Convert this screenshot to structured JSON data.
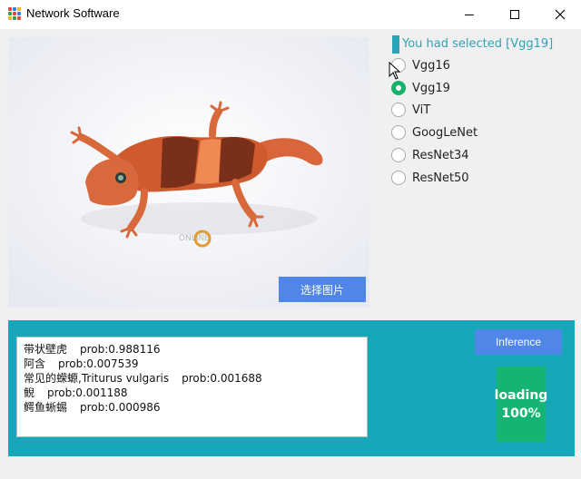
{
  "window": {
    "title": "Network Software"
  },
  "image_panel": {
    "image_subject": "gecko",
    "watermark": "ONLINE",
    "select_button_label": "选择图片"
  },
  "model_selection": {
    "selected_text": "You had selected [Vgg19]",
    "options": [
      {
        "label": "Vgg16",
        "checked": false
      },
      {
        "label": "Vgg19",
        "checked": true
      },
      {
        "label": "ViT",
        "checked": false
      },
      {
        "label": "GoogLeNet",
        "checked": false
      },
      {
        "label": "ResNet34",
        "checked": false
      },
      {
        "label": "ResNet50",
        "checked": false
      }
    ]
  },
  "results": [
    {
      "name": "带状壁虎",
      "prob": "prob:0.988116"
    },
    {
      "name": "阿含",
      "prob": "prob:0.007539"
    },
    {
      "name": "常见的蝾螈,Triturus vulgaris",
      "prob": "prob:0.001688"
    },
    {
      "name": "鲵",
      "prob": "prob:0.001188"
    },
    {
      "name": "鳄鱼蜥蜴",
      "prob": "prob:0.000986"
    }
  ],
  "inference": {
    "button_label": "Inference",
    "loading_label": "loading",
    "progress_text": "100%"
  },
  "colors": {
    "accent_teal": "#16a8b8",
    "button_blue": "#4f86e8",
    "loading_green": "#16b472",
    "radio_checked": "#17b26a"
  }
}
